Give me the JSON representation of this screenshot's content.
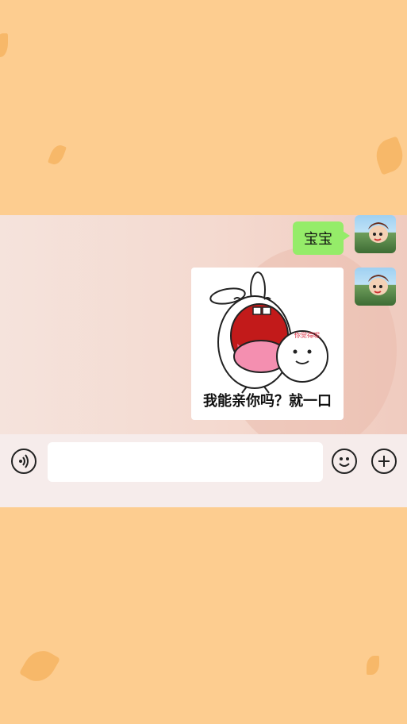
{
  "chat": {
    "messages": [
      {
        "type": "text",
        "sender": "self",
        "text": "宝宝"
      },
      {
        "type": "sticker",
        "sender": "self",
        "caption": "我能亲你吗？就一口",
        "small_text": "你觉得呢"
      }
    ]
  },
  "input_bar": {
    "value": "",
    "left_icon": "voice-icon",
    "right_icons": [
      "emoji-icon",
      "plus-icon"
    ]
  },
  "colors": {
    "background": "#fdcd90",
    "bubble": "#95ec69",
    "input_bar": "#f6eceb"
  }
}
